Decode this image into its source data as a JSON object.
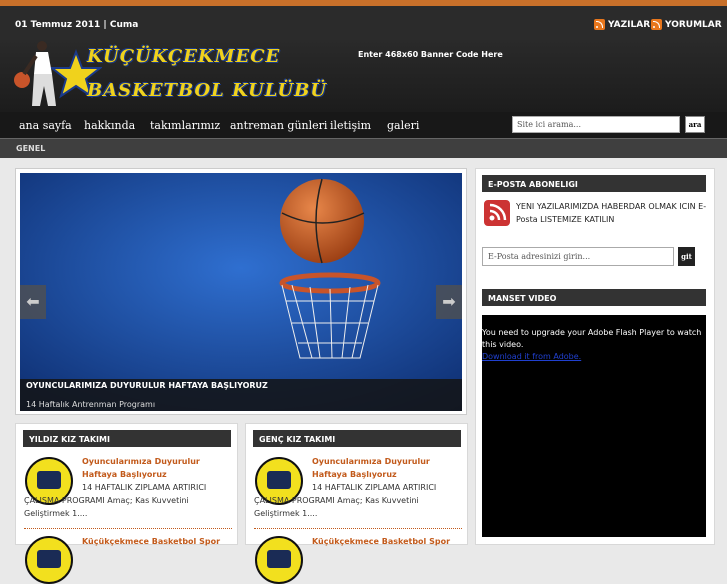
{
  "topbar": {
    "date": "01 Temmuz 2011 | Cuma",
    "feed_posts": "YAZILAR",
    "feed_comments": "YORUMLAR"
  },
  "header": {
    "logo_line1": "KÜÇÜKÇEKMECE",
    "logo_line2": "BASKETBOL KULÜBÜ",
    "banner": "Enter 468x60 Banner Code Here"
  },
  "nav": {
    "items": [
      "ana sayfa",
      "hakkında",
      "takımlarımız",
      "antreman günleri",
      "iletişim",
      "galeri"
    ],
    "search_placeholder": "Site ici arama...",
    "search_button": "ara"
  },
  "subnav": {
    "label": "GENEL"
  },
  "slider": {
    "title": "OYUNCULARIMIZA DUYURULUR HAFTAYA BAŞLIYORUZ",
    "subtitle": "14 Haftalık Antrenman Programı"
  },
  "panels": [
    {
      "title": "YILDIZ KIZ TAKIMI",
      "post_title": "Oyuncularımıza Duyurulur Haftaya Başlıyoruz",
      "post_body": "14 HAFTALIK ZIPLAMA ARTIRICI ÇALIŞMA PROGRAMI Amaç; Kas Kuvvetini Geliştirmek 1....",
      "next_title": "Küçükçekmece Basketbol Spor"
    },
    {
      "title": "GENÇ KIZ TAKIMI",
      "post_title": "Oyuncularımıza Duyurulur Haftaya Başlıyoruz",
      "post_body": "14 HAFTALIK ZIPLAMA ARTIRICI ÇALIŞMA PROGRAMI Amaç; Kas Kuvvetini Geliştirmek 1....",
      "next_title": "Küçükçekmece Basketbol Spor"
    }
  ],
  "sidebar": {
    "email_title": "E-POSTA ABONELIGI",
    "email_text": "YENI YAZILARIMIZDA HABERDAR OLMAK ICIN E-Posta LISTEMIZE KATILIN",
    "email_placeholder": "E-Posta adresinizi girin...",
    "email_button": "git",
    "video_title": "MANSET VIDEO",
    "video_text": "You need to upgrade your Adobe Flash Player to watch this video.",
    "video_link": "Download it from Adobe."
  }
}
